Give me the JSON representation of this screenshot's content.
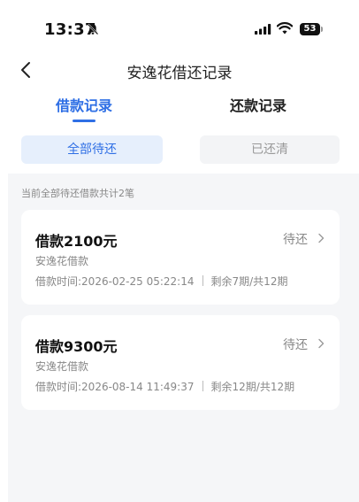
{
  "status_bar": {
    "time": "13:37",
    "battery": "53",
    "icons": [
      "bell-mute-icon",
      "cellular-signal-icon",
      "wifi-icon",
      "battery-icon"
    ]
  },
  "header": {
    "title": "安逸花借还记录",
    "back_icon": "chevron-left-icon"
  },
  "tabs": [
    {
      "label": "借款记录",
      "active": true
    },
    {
      "label": "还款记录",
      "active": false
    }
  ],
  "filters": [
    {
      "label": "全部待还",
      "active": true
    },
    {
      "label": "已还清",
      "active": false
    }
  ],
  "summary": "当前全部待还借款共计2笔",
  "loans": [
    {
      "amount": "借款2100元",
      "status": "待还",
      "product": "安逸花借款",
      "date": "借款时间:2026-02-25 05:22:14",
      "remaining": "剩余7期/共12期"
    },
    {
      "amount": "借款9300元",
      "status": "待还",
      "product": "安逸花借款",
      "date": "借款时间:2026-08-14 11:49:37",
      "remaining": "剩余12期/共12期"
    }
  ],
  "colors": {
    "accent": "#2f6fe5",
    "accent_bg": "#e6effc",
    "page_bg": "#f5f6f8",
    "muted_text": "#888888"
  }
}
